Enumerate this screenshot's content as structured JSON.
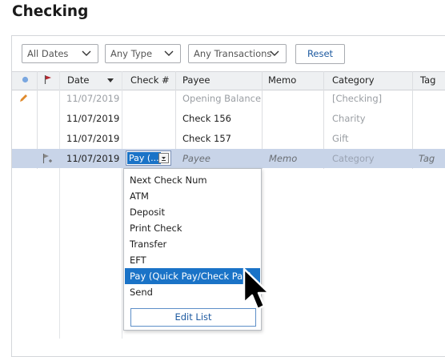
{
  "page": {
    "title": "Checking"
  },
  "filters": {
    "dates": "All Dates",
    "type": "Any Type",
    "transactions": "Any Transactions",
    "reset_label": "Reset"
  },
  "columns": {
    "date": "Date",
    "check": "Check #",
    "payee": "Payee",
    "memo": "Memo",
    "category": "Category",
    "tag": "Tag"
  },
  "rows": [
    {
      "date": "11/07/2019",
      "check": "",
      "payee": "Opening Balance",
      "memo": "",
      "category": "[Checking]",
      "tag": ""
    },
    {
      "date": "11/07/2019",
      "check": "",
      "payee": "Check 156",
      "memo": "",
      "category": "Charity",
      "tag": ""
    },
    {
      "date": "11/07/2019",
      "check": "",
      "payee": "Check 157",
      "memo": "",
      "category": "Gift",
      "tag": ""
    }
  ],
  "edit_row": {
    "date": "11/07/2019",
    "check_value": "Pay (...",
    "payee_placeholder": "Payee",
    "memo_placeholder": "Memo",
    "category_placeholder": "Category",
    "tag_placeholder": "Tag"
  },
  "check_menu": {
    "items": [
      "Next Check Num",
      "ATM",
      "Deposit",
      "Print Check",
      "Transfer",
      "EFT",
      "Pay (Quick Pay/Check Pay)",
      "Send"
    ],
    "highlighted": "Pay (Quick Pay/Check Pay)",
    "edit_list_label": "Edit List"
  },
  "colors": {
    "accent": "#1a73c7",
    "edit_row": "#c8d4e8",
    "flag": "#b3262e",
    "status_dot": "#7aa7e0",
    "pencil": "#e08a2c"
  }
}
